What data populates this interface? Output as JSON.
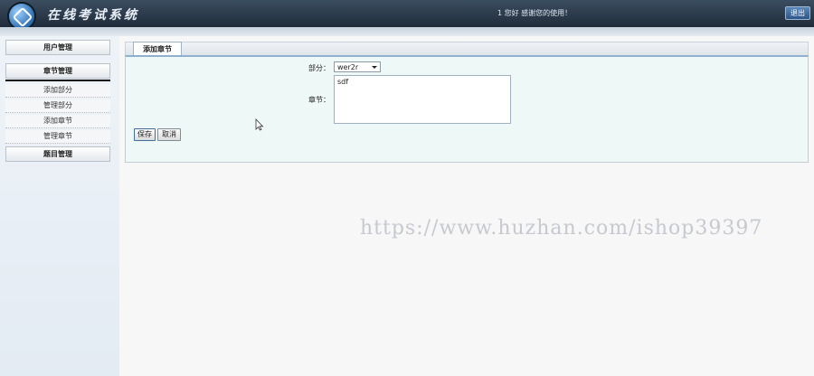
{
  "header": {
    "app_title": "在线考试系统",
    "welcome_text": "1 您好 感谢您的使用！",
    "logout_label": "退出"
  },
  "sidebar": {
    "sections": [
      {
        "label": "用户管理"
      },
      {
        "label": "章节管理"
      }
    ],
    "chapter_items": [
      {
        "label": "添加部分"
      },
      {
        "label": "管理部分"
      },
      {
        "label": "添加章节"
      },
      {
        "label": "管理章节"
      }
    ],
    "topic_section": {
      "label": "题目管理"
    }
  },
  "main": {
    "tab_label": "添加章节",
    "form": {
      "part_label": "部分：",
      "part_selected": "wer2r",
      "chapter_label": "章节：",
      "chapter_value": "sdf"
    },
    "save_label": "保存",
    "cancel_label": "取消"
  },
  "watermark": "https://www.huzhan.com/ishop39397"
}
